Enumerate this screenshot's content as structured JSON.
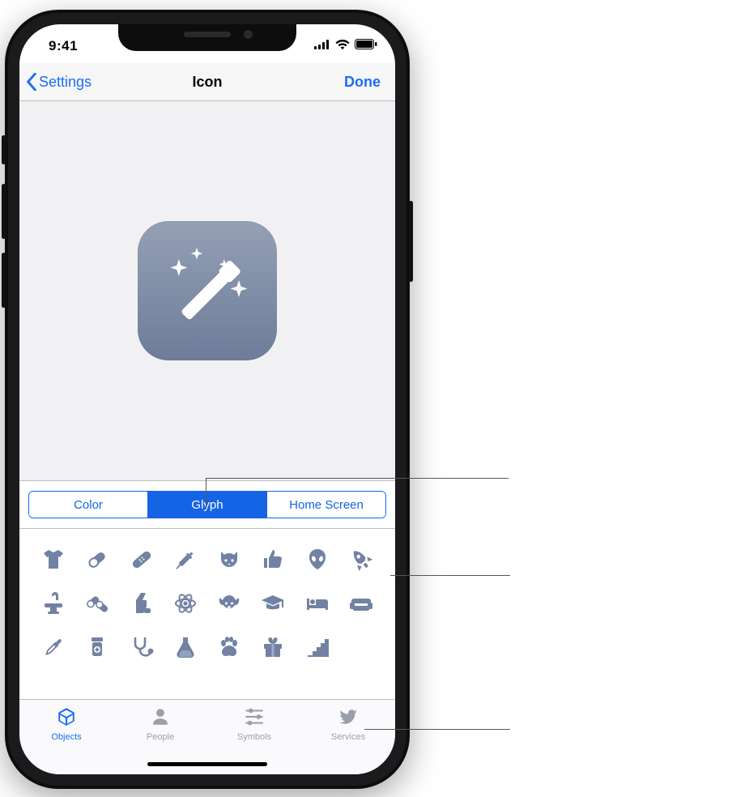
{
  "status": {
    "time": "9:41"
  },
  "nav": {
    "back_label": "Settings",
    "title": "Icon",
    "done_label": "Done"
  },
  "preview": {
    "icon_name": "magic-wand-sparkles"
  },
  "segments": [
    {
      "label": "Color",
      "selected": false
    },
    {
      "label": "Glyph",
      "selected": true
    },
    {
      "label": "Home Screen",
      "selected": false
    }
  ],
  "glyph_grid": [
    [
      "shirt",
      "pill",
      "bandage",
      "syringe",
      "cat-face",
      "thumbs-up",
      "alien",
      "rocket"
    ],
    [
      "sink",
      "pills",
      "inhaler",
      "atom",
      "dog-face",
      "graduation-cap",
      "bed",
      "sofa"
    ],
    [
      "dropper",
      "pill-bottle",
      "stethoscope",
      "flask",
      "paw",
      "gift",
      "stairs",
      ""
    ]
  ],
  "tabs": [
    {
      "label": "Objects",
      "icon": "cube",
      "active": true
    },
    {
      "label": "People",
      "icon": "person",
      "active": false
    },
    {
      "label": "Symbols",
      "icon": "sliders",
      "active": false
    },
    {
      "label": "Services",
      "icon": "twitter",
      "active": false
    }
  ],
  "colors": {
    "accent": "#1b6df4",
    "glyph": "#7182a3"
  }
}
